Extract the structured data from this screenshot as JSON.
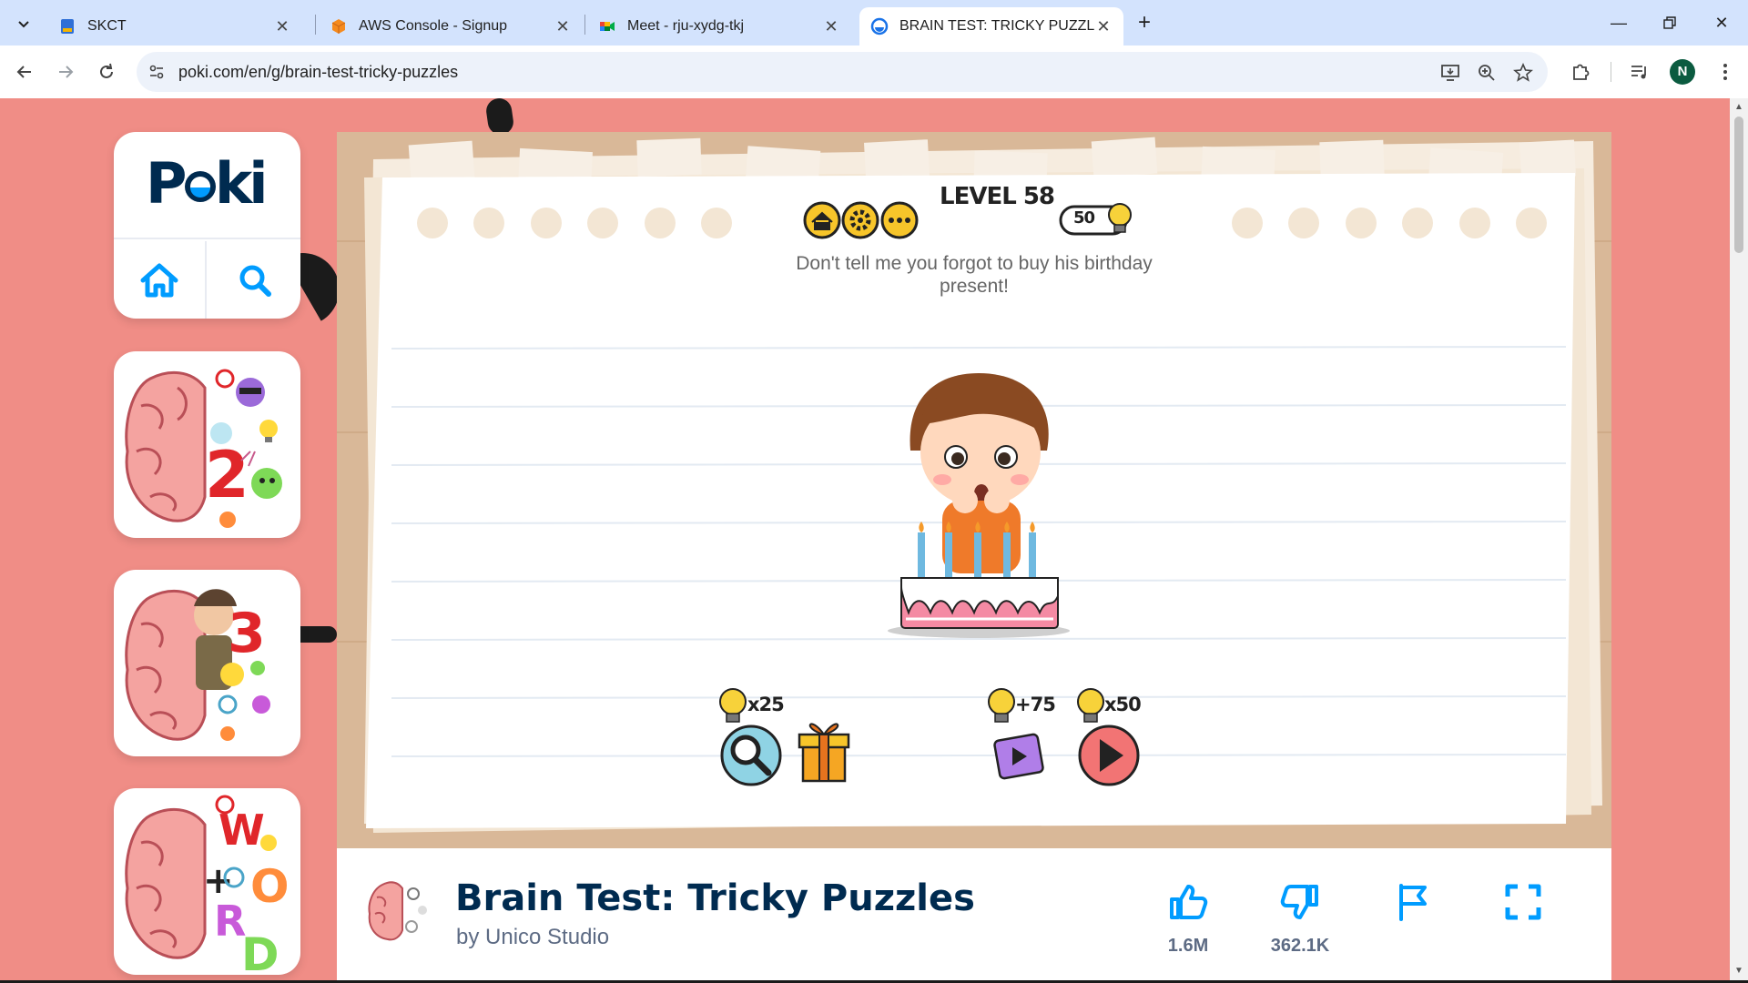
{
  "browser": {
    "tabs": [
      {
        "title": "SKCT",
        "active": false
      },
      {
        "title": "AWS Console - Signup",
        "active": false
      },
      {
        "title": "Meet - rju-xydg-tkj",
        "active": false
      },
      {
        "title": "BRAIN TEST: TRICKY PUZZLES",
        "active": true
      }
    ],
    "url": "poki.com/en/g/brain-test-tricky-puzzles",
    "profile_initial": "N"
  },
  "sidebar": {
    "logo": "Poki",
    "thumbnails": [
      "brain-test-2",
      "brain-test-3",
      "brain-test-words"
    ]
  },
  "game": {
    "level_label": "LEVEL 58",
    "hint_count": "50",
    "question": "Don't tell me you forgot to buy his birthday present!",
    "hint_cost": "x25",
    "video_reward": "+75",
    "skip_cost": "x50"
  },
  "game_info": {
    "title": "Brain Test: Tricky Puzzles",
    "author": "by Unico Studio",
    "likes": "1.6M",
    "dislikes": "362.1K"
  },
  "colors": {
    "page_bg": "#f08d86",
    "poki_blue": "#009cff",
    "poki_navy": "#002b50",
    "tabbar_bg": "#d3e3fd"
  }
}
